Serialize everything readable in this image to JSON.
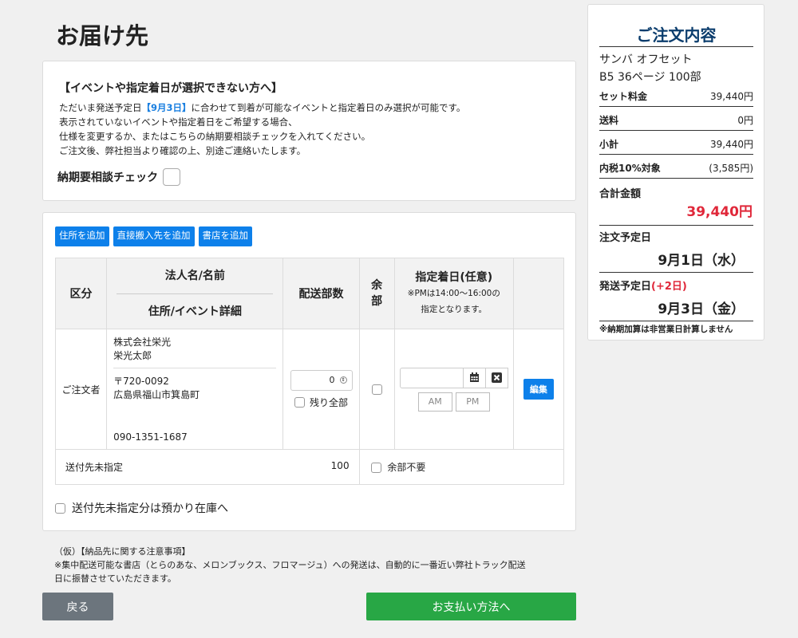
{
  "page_title": "お届け先",
  "notice": {
    "title": "【イベントや指定着日が選択できない方へ】",
    "line1_pre": "ただいま発送予定日",
    "line1_highlight": "【9月3日】",
    "line1_post": "に合わせて到着が可能なイベントと指定着日のみ選択が可能です。",
    "line2": "表示されていないイベントや指定着日をご希望する場合、",
    "line3": "仕様を変更するか、またはこちらの納期要相談チェックを入れてください。",
    "line4": "ご注文後、弊社担当より確認の上、別途ご連絡いたします。",
    "consult_label": "納期要相談チェック"
  },
  "shipping": {
    "buttons": [
      "住所を追加",
      "直接搬入先を追加",
      "書店を追加"
    ],
    "headers": {
      "category": "区分",
      "name": "法人名/名前",
      "address": "住所/イベント詳細",
      "qty": "配送部数",
      "all": "余部",
      "date": "指定着日(任意)",
      "date_note1": "※PMは14:00〜16:00の",
      "date_note2": "指定となります。"
    },
    "row": {
      "category": "ご注文者",
      "company": "株式会社栄光",
      "person": "栄光太郎",
      "zip": "〒720-0092",
      "address": "広島県福山市箕島町",
      "phone": "090-1351-1687",
      "qty": "0",
      "rest_all": "残り全部",
      "am": "AM",
      "pm": "PM",
      "edit": "編集"
    },
    "unassigned": {
      "label": "送付先未指定",
      "qty": "100",
      "no_spare": "余部不要"
    },
    "stock_label": "送付先未指定分は預かり在庫へ"
  },
  "footnote": {
    "line1": "（仮）【納品先に関する注意事項】",
    "line2": "※集中配送可能な書店（とらのあな、メロンブックス、フロマージュ）への発送は、自動的に一番近い弊社トラック配送",
    "line3": "日に振替させていただきます。"
  },
  "actions": {
    "back": "戻る",
    "pay": "お支払い方法へ"
  },
  "order": {
    "title": "ご注文内容",
    "product_line1": "サンバ オフセット",
    "product_line2": "B5 36ページ 100部",
    "set_label": "セット料金",
    "set_value": "39,440円",
    "shipping_label": "送料",
    "shipping_value": "0円",
    "subtotal_label": "小計",
    "subtotal_value": "39,440円",
    "tax_label": "内税10%対象",
    "tax_value": "(3,585円)",
    "total_label": "合計金額",
    "total_value": "39,440円",
    "order_date_label": "注文予定日",
    "order_date_value": "9月1日（水）",
    "ship_date_label": "発送予定日",
    "ship_date_extra": "(+2日)",
    "ship_date_value": "9月3日（金）",
    "note": "※納期加算は非営業日計算しません"
  }
}
